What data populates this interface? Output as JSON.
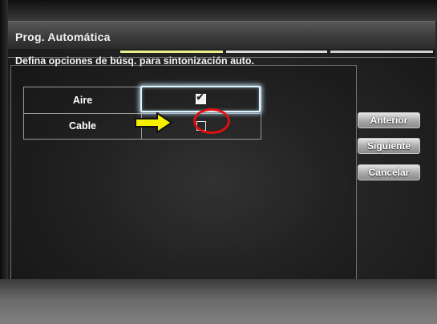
{
  "screen": {
    "title": "Prog. Automática",
    "instruction": "Defina opciones de búsq. para sintonización auto."
  },
  "options": [
    {
      "label": "Aire",
      "checked": true,
      "focused": true
    },
    {
      "label": "Cable",
      "checked": false,
      "focused": false
    }
  ],
  "buttons": {
    "prev": "Anterior",
    "next": "Siguiente",
    "cancel": "Cancelar"
  },
  "wizard": {
    "current_step": 1,
    "total_steps": 3
  },
  "colors": {
    "active_step": "#e8f18a",
    "focus_glow": "#dff3ff",
    "annotation_arrow": "#f5f000",
    "annotation_circle": "#e01010"
  },
  "icons": {
    "checked": "checkbox-checked-icon",
    "unchecked": "checkbox-empty-icon",
    "annotation_arrow": "arrow-right-icon",
    "annotation_circle": "highlight-circle"
  }
}
